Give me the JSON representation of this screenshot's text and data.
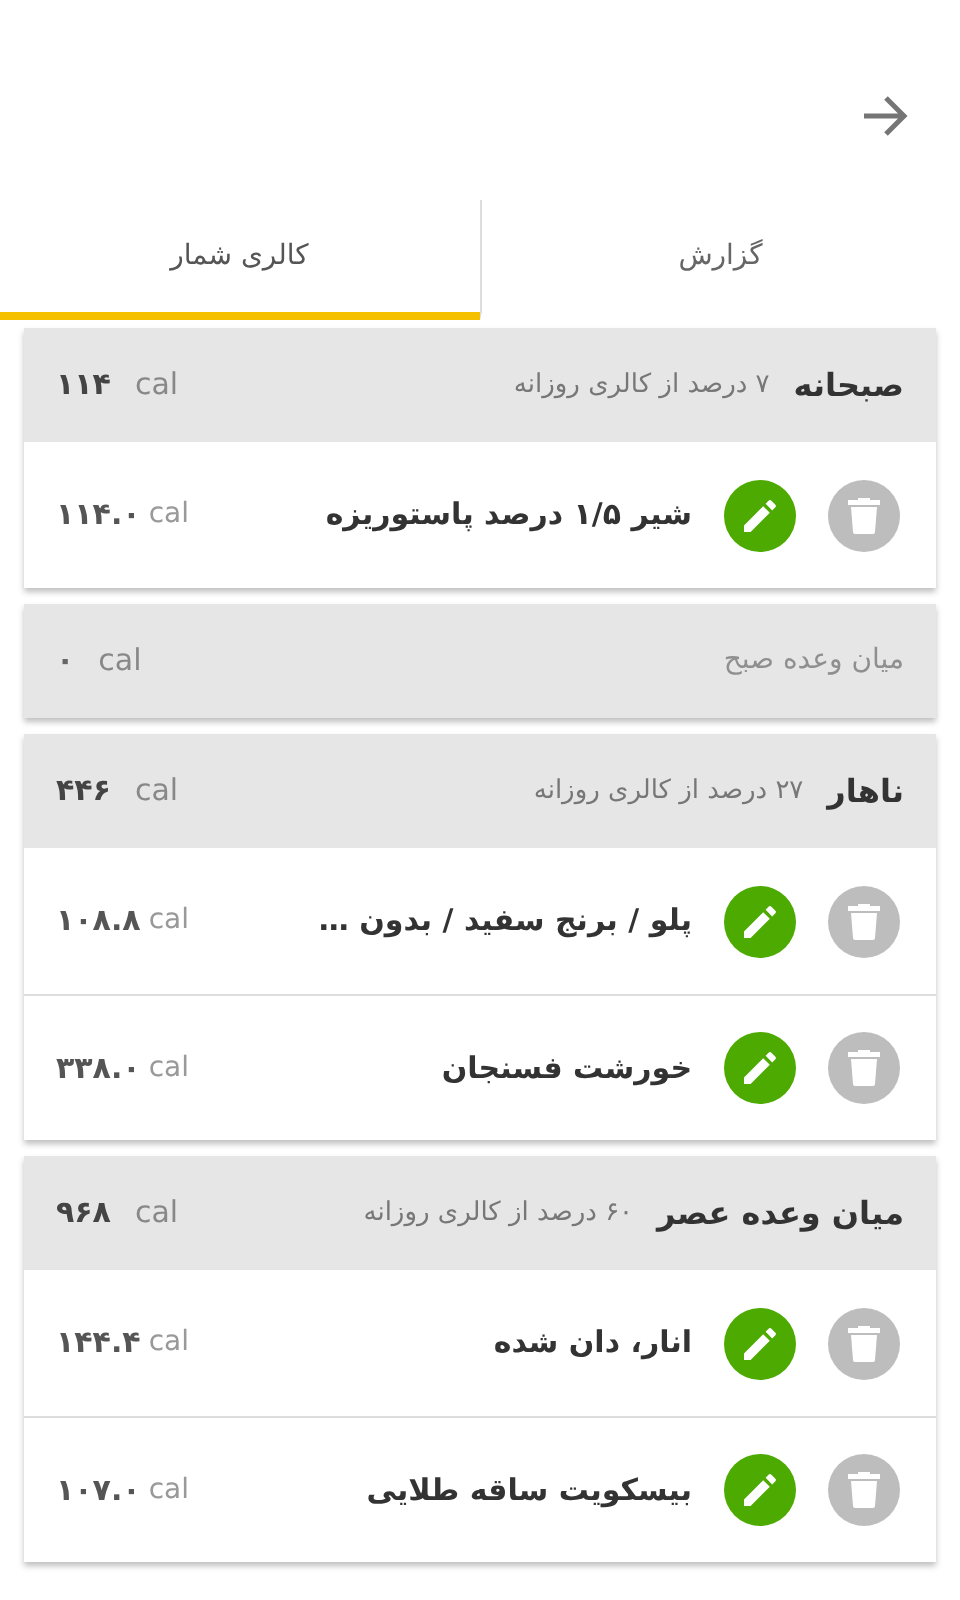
{
  "tabs": [
    {
      "label": "گزارش",
      "selected": false
    },
    {
      "label": "کالری شمار",
      "selected": true
    }
  ],
  "meals": [
    {
      "title": "صبحانه",
      "subtitle": "۷ درصد از کالری روزانه",
      "unit": "cal",
      "total": "۱۱۴",
      "dimmed": false,
      "items": [
        {
          "name": "شیر ۱/۵ درصد پاستوریزه",
          "unit": "cal",
          "calories": "۱۱۴.۰"
        }
      ]
    },
    {
      "title": "میان وعده صبح",
      "unit": "cal",
      "total": "۰",
      "dimmed": true
    },
    {
      "title": "ناهار",
      "subtitle": "۲۷ درصد از کالری روزانه",
      "unit": "cal",
      "total": "۴۴۶",
      "dimmed": false,
      "items": [
        {
          "name": "پلو / برنج سفید / بدون …",
          "unit": "cal",
          "calories": "۱۰۸.۸"
        },
        {
          "name": "خورشت فسنجان",
          "unit": "cal",
          "calories": "۳۳۸.۰"
        }
      ]
    },
    {
      "title": "میان وعده عصر",
      "subtitle": "۶۰ درصد از کالری روزانه",
      "unit": "cal",
      "total": "۹۶۸",
      "dimmed": false,
      "items": [
        {
          "name": "انار، دان شده",
          "unit": "cal",
          "calories": "۱۴۴.۴"
        },
        {
          "name": "بیسکویت ساقه طلایی",
          "unit": "cal",
          "calories": "۱۰۷.۰"
        }
      ]
    }
  ]
}
